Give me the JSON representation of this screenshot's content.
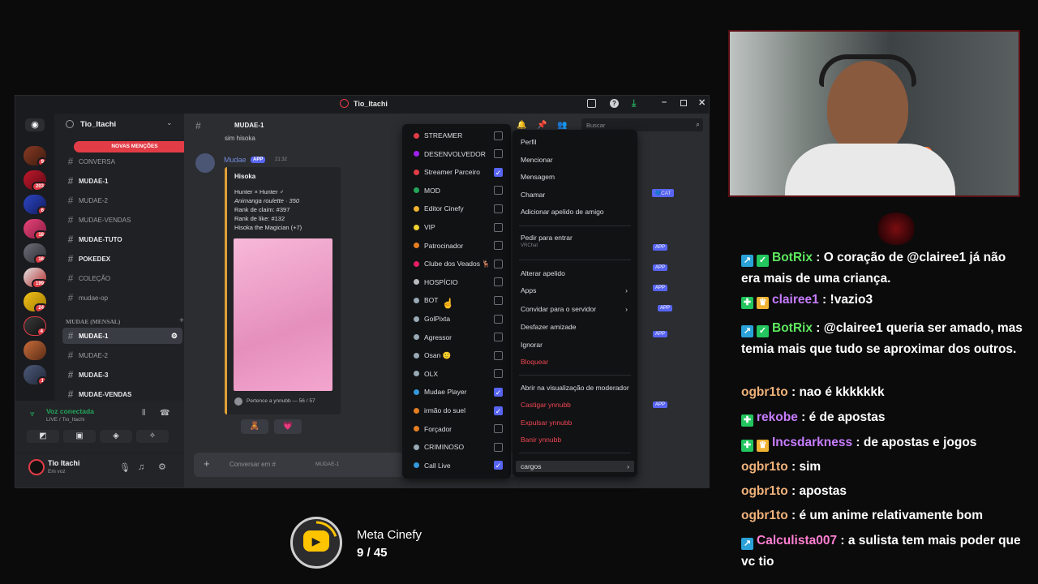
{
  "window": {
    "title": "Tio_Itachi"
  },
  "guilds": [
    {
      "badge": "9"
    },
    {
      "badge": "203"
    },
    {
      "badge": "6"
    },
    {
      "badge": "18"
    },
    {
      "badge": "16"
    },
    {
      "badge": "199"
    },
    {
      "badge": "24"
    },
    {
      "badge": "4"
    },
    {
      "badge": ""
    },
    {
      "badge": "1"
    }
  ],
  "server": {
    "name": "Tio_Itachi",
    "mentions_pill": "NOVAS MENÇÕES"
  },
  "channels": [
    {
      "name": "CONVERSA"
    },
    {
      "name": "MUDAE-1"
    },
    {
      "name": "MUDAE-2"
    },
    {
      "name": "MUDAE-VENDAS"
    },
    {
      "name": "MUDAE-TUTO"
    },
    {
      "name": "POKEDEX"
    },
    {
      "name": "COLEÇÃO"
    },
    {
      "name": "mudae-op"
    }
  ],
  "category": {
    "name": "MUDAE (MENSAL)"
  },
  "channels2": [
    {
      "name": "MUDAE-1"
    },
    {
      "name": "MUDAE-2"
    },
    {
      "name": "MUDAE-3"
    },
    {
      "name": "MUDAE-VENDAS"
    }
  ],
  "voice": {
    "status": "Voz conectada",
    "channel": "LIVE / Tio_Itachi"
  },
  "user": {
    "name": "Tio Itachi",
    "status": "Em voz"
  },
  "chat_header": {
    "channel": "MUDAE-1",
    "search_placeholder": "Buscar"
  },
  "message": {
    "prev_text": "sim hisoka",
    "author": "Mudae",
    "app_tag": "APP",
    "time": "21:32",
    "embed_title": "Hisoka",
    "line1": "Hunter × Hunter ♂",
    "line2": "Animanga roulette · 350",
    "line3": "Rank de claim: #397",
    "line4": "Rank de like: #132",
    "line5": "Hisoka the Magician (+7)",
    "footer": "Pertence a ynnubb — 56 / 57"
  },
  "composer": {
    "placeholder": "Conversar em #",
    "channel": "MUDAE-1"
  },
  "roles": [
    {
      "name": "STREAMER",
      "color": "#e23c46",
      "checked": false
    },
    {
      "name": "DESENVOLVEDOR",
      "color": "#a020f0",
      "checked": false
    },
    {
      "name": "Streamer Parceiro",
      "color": "#e23c46",
      "checked": true
    },
    {
      "name": "MOD",
      "color": "#23a55a",
      "checked": false
    },
    {
      "name": "Editor Cinefy",
      "color": "#f0b232",
      "checked": false
    },
    {
      "name": "VIP",
      "color": "#f0d232",
      "checked": false
    },
    {
      "name": "Patrocinador",
      "color": "#e67e22",
      "checked": false
    },
    {
      "name": "Clube dos Veados 🦌",
      "color": "#e91e63",
      "checked": false
    },
    {
      "name": "HOSPÍCIO",
      "color": "#b9bbbe",
      "checked": false
    },
    {
      "name": "BOT",
      "color": "#99aab5",
      "checked": false
    },
    {
      "name": "GolPixta",
      "color": "#99aab5",
      "checked": false
    },
    {
      "name": "Agressor",
      "color": "#99aab5",
      "checked": false
    },
    {
      "name": "Osan 🙂",
      "color": "#99aab5",
      "checked": false
    },
    {
      "name": "OLX",
      "color": "#99aab5",
      "checked": false
    },
    {
      "name": "Mudae Player",
      "color": "#3498db",
      "checked": true
    },
    {
      "name": "irmão do suel",
      "color": "#e67e22",
      "checked": true
    },
    {
      "name": "Forçador",
      "color": "#e67e22",
      "checked": false
    },
    {
      "name": "CRIMINOSO",
      "color": "#99aab5",
      "checked": false
    },
    {
      "name": "Call Live",
      "color": "#3498db",
      "checked": true
    }
  ],
  "context_menu": {
    "perfil": "Perfil",
    "mencionar": "Mencionar",
    "mensagem": "Mensagem",
    "chamar": "Chamar",
    "adicionar_apelido": "Adicionar apelido de amigo",
    "pedir_entrar": "Pedir para entrar",
    "pedir_entrar_sub": "VRChat",
    "alterar_apelido": "Alterar apelido",
    "apps": "Apps",
    "convidar": "Convidar para o servidor",
    "desfazer": "Desfazer amizade",
    "ignorar": "Ignorar",
    "bloquear": "Bloquear",
    "abrir_mod": "Abrir na visualização de moderador",
    "castigar": "Castigar ynnubb",
    "expulsar": "Expulsar ynnubb",
    "banir": "Banir ynnubb",
    "cargos": "cargos"
  },
  "stream_chat": [
    {
      "user": "BotRix",
      "color": "#5ee85e",
      "text": "O coração de @clairee1 já não era mais de uma criança.",
      "badges": [
        "kick",
        "check"
      ]
    },
    {
      "user": "clairee1",
      "color": "#c77dff",
      "text": "!vazio3",
      "badges": [
        "plus",
        "crown"
      ]
    },
    {
      "user": "BotRix",
      "color": "#5ee85e",
      "text": "@clairee1 queria ser amado, mas temia mais que tudo se aproximar dos outros.",
      "badges": [
        "kick",
        "check"
      ]
    },
    {
      "user": "ogbr1to",
      "color": "#f0b27a",
      "text": "nao é kkkkkkk",
      "badges": []
    },
    {
      "user": "rekobe",
      "color": "#c77dff",
      "text": "é de apostas",
      "badges": [
        "plus"
      ]
    },
    {
      "user": "Incsdarkness",
      "color": "#c77dff",
      "text": "de apostas e jogos",
      "badges": [
        "plus",
        "crown"
      ]
    },
    {
      "user": "ogbr1to",
      "color": "#f0b27a",
      "text": "sim",
      "badges": []
    },
    {
      "user": "ogbr1to",
      "color": "#f0b27a",
      "text": "apostas",
      "badges": []
    },
    {
      "user": "ogbr1to",
      "color": "#f0b27a",
      "text": "é um anime relativamente bom",
      "badges": []
    },
    {
      "user": "Calculista007",
      "color": "#ff7fd0",
      "text": "a sulista tem mais poder que vc tio",
      "badges": [
        "kick"
      ]
    }
  ],
  "goal": {
    "title": "Meta Cinefy",
    "progress": "9 / 45",
    "current": 9,
    "target": 45
  }
}
